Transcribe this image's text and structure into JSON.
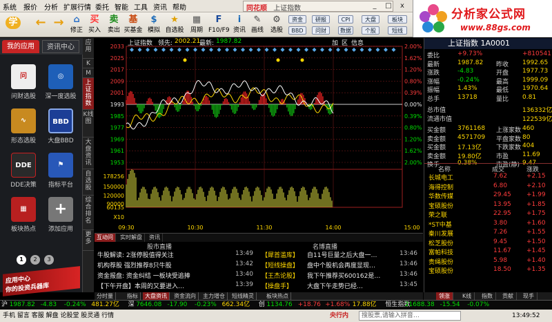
{
  "menubar": {
    "items": [
      "系统",
      "报价",
      "分析",
      "扩展行情",
      "委托",
      "智能",
      "工具",
      "资讯",
      "帮助"
    ],
    "brand": "同花顺",
    "title": "上证指数",
    "win_buttons": [
      "_",
      "□",
      "x"
    ]
  },
  "toolbar": {
    "buttons": [
      {
        "icon": "学",
        "label": ""
      },
      {
        "icon": "←",
        "label": ""
      },
      {
        "icon": "→",
        "label": ""
      },
      {
        "icon": "⌂",
        "label": ""
      },
      {
        "icon": "✔",
        "label": "修正"
      },
      {
        "icon": "买",
        "label": "买入"
      },
      {
        "icon": "卖",
        "label": "卖出"
      },
      {
        "icon": "基",
        "label": "买基金"
      },
      {
        "icon": "$",
        "label": "模拟"
      },
      {
        "icon": "★",
        "label": "自选股"
      },
      {
        "icon": "▦",
        "label": "周期"
      },
      {
        "icon": "F",
        "label": "F10/F9"
      },
      {
        "icon": "i",
        "label": "资讯"
      },
      {
        "icon": "✎",
        "label": "画线"
      },
      {
        "icon": "⚙",
        "label": "选股"
      }
    ],
    "small": [
      "资金",
      "BBD",
      "研报",
      "问财",
      "CPI",
      "数据",
      "大盘",
      "个股",
      "板块",
      "短线"
    ]
  },
  "logo": {
    "title": "分析家公式网",
    "url": "www.88gs.com"
  },
  "left": {
    "tab_active": "我的应用",
    "tab_other": "资讯中心",
    "apps": [
      {
        "label": "问财选股",
        "tile": "问",
        "color": "#eeeeee"
      },
      {
        "label": "深一度选股",
        "tile": "◎",
        "color": "#1e5fb8"
      },
      {
        "label": "形态选股",
        "tile": "∿",
        "color": "#c88a20"
      },
      {
        "label": "大盘BBD",
        "tile": "BBD",
        "color": "#1c3e96"
      },
      {
        "label": "DDE决策",
        "tile": "DDE",
        "color": "#2a2a2a"
      },
      {
        "label": "指标平台",
        "tile": "⚑",
        "color": "#2858b8"
      },
      {
        "label": "板块热点",
        "tile": "▦",
        "color": "#b82020"
      },
      {
        "label": "添加应用",
        "tile": "+",
        "color": "#777777"
      }
    ],
    "pages": [
      "1",
      "2",
      "3"
    ],
    "banner_line1": "应用中心",
    "banner_line2": "你的投资兵器库"
  },
  "vtabs": [
    "应用",
    "K",
    "M",
    "上证指数",
    "K线图",
    "大盘资讯",
    "自选股",
    "综合排名",
    "更多"
  ],
  "chart": {
    "index_name": "上证指数",
    "lead_label": "领先:",
    "lead_val": "2002.21",
    "latest_label": "最新:",
    "latest_val": "1987.82",
    "tools": [
      "加",
      "区",
      "信息"
    ],
    "y_labels": [
      "2033",
      "2025",
      "2017",
      "2009",
      "2001",
      "1993",
      "1985",
      "1977",
      "1969",
      "1961",
      "1953"
    ],
    "pct_labels": [
      "2.00%",
      "1.62%",
      "1.20%",
      "0.80%",
      "0.39%",
      "0.00%",
      "0.39%",
      "0.80%",
      "1.20%",
      "1.62%",
      "2.00%"
    ],
    "vol_labels": [
      "178256",
      "150000",
      "120000",
      "90000",
      "60135",
      "X10"
    ],
    "time_labels": [
      "09:30",
      "10:30",
      "11:30",
      "14:00",
      "15:00"
    ],
    "chart_data": {
      "type": "line",
      "title": "上证指数",
      "ref_price": 1993,
      "x": [
        "09:30",
        "10:30",
        "11:30",
        "14:00",
        "15:00"
      ],
      "series": [
        {
          "name": "上证指数",
          "values": [
            1975,
            2005,
            2004,
            1990
          ]
        },
        {
          "name": "领先",
          "values": [
            1978,
            1998,
            2000,
            1990
          ]
        }
      ]
    }
  },
  "news": {
    "tabs": [
      "互动问",
      "实时解盘",
      "资讯"
    ],
    "col1": "股市直播",
    "col2": "名博直播",
    "rows1": [
      {
        "text": "牛股解读: 2涨停股值得关注",
        "time": "13:49"
      },
      {
        "text": "机构荐股 强烈推荐8只牛股",
        "time": "13:42"
      },
      {
        "text": "资金报盘: 资金纠结 一板块受追捧",
        "time": "13:40"
      },
      {
        "text": "【下午开盘】本周的又要进入…",
        "time": "13:39"
      }
    ],
    "rows2": [
      {
        "tag": "【犀首滥库】",
        "text": "自11号巨量之后大盘一…",
        "time": "13:46"
      },
      {
        "tag": "【短线操盘】",
        "text": "盘中个股机会再度显现…",
        "time": "13:46"
      },
      {
        "tag": "【王杰论股】",
        "text": "我下午推荐买600162是…",
        "time": "13:46"
      },
      {
        "tag": "【操盘手】",
        "text": "大盘下午走势已经…",
        "time": "13:45"
      }
    ]
  },
  "bottomtabs": [
    "分时量",
    "指标",
    "大盘资讯",
    "资金流向",
    "主力增仓",
    "短线精灵",
    "板块热点"
  ],
  "quote": {
    "title": "上证指数 1A0001",
    "rows": [
      {
        "l": "委比",
        "v": "+9.73%",
        "r": "+810541"
      },
      {
        "l": "最新",
        "v": "1987.82",
        "rl": "昨收",
        "r": "1992.65"
      },
      {
        "l": "涨跌",
        "v": "-4.83",
        "rl": "开盘",
        "r": "1977.73"
      },
      {
        "l": "涨幅",
        "v": "-0.24%",
        "rl": "最高",
        "r": "1999.09"
      },
      {
        "l": "振幅",
        "v": "1.43%",
        "rl": "最低",
        "r": "1970.64"
      },
      {
        "l": "总手",
        "v": "13718",
        "rl": "量比",
        "r": "0.81"
      },
      {
        "l": "总市值",
        "v": "",
        "r": "136332亿"
      },
      {
        "l": "流通市值",
        "v": "",
        "r": "122539亿"
      },
      {
        "l": "买金额",
        "v": "3761168",
        "rl": "上涨家数",
        "r": "460"
      },
      {
        "l": "卖金额",
        "v": "4571709",
        "rl": "平盘家数",
        "r": "80"
      },
      {
        "l": "买金额",
        "v": "17.13亿",
        "rl": "下跌家数",
        "r": "404"
      },
      {
        "l": "卖金额",
        "v": "19.80亿",
        "rl": "市盈",
        "r": "11.69"
      },
      {
        "l": "换手",
        "v": "0.38%",
        "rl": "市盈(静)",
        "r": "9.47"
      }
    ],
    "stock_headers": [
      "名称",
      "成交",
      "涨跌"
    ],
    "stocks": [
      {
        "name": "长城电工",
        "price": "7.62",
        "chg": "+2.15"
      },
      {
        "name": "海得控制",
        "price": "6.80",
        "chg": "+2.10"
      },
      {
        "name": "华数传媒",
        "price": "29.45",
        "chg": "+1.99"
      },
      {
        "name": "宝硕股份",
        "price": "13.95",
        "chg": "+1.85"
      },
      {
        "name": "荣之联",
        "price": "22.95",
        "chg": "+1.75"
      },
      {
        "name": "*ST中基",
        "price": "3.80",
        "chg": "+1.60"
      },
      {
        "name": "秦川发展",
        "price": "7.26",
        "chg": "+1.55"
      },
      {
        "name": "松芝股份",
        "price": "9.45",
        "chg": "+1.50"
      },
      {
        "name": "富帕科技",
        "price": "11.67",
        "chg": "+1.45"
      },
      {
        "name": "贵绳股份",
        "price": "5.98",
        "chg": "+1.40"
      },
      {
        "name": "宝硕股份",
        "price": "18.50",
        "chg": "+1.35"
      }
    ],
    "tabs": [
      "领涨",
      "K线",
      "指数",
      "贡献",
      "现手"
    ]
  },
  "ticker": {
    "items": [
      {
        "n": "沪",
        "v": "1987.82",
        "c": "-4.83",
        "p": "-0.24%",
        "a": "481.27亿"
      },
      {
        "n": "深",
        "v": "7646.08",
        "c": "-17.90",
        "p": "-0.23%",
        "a": "662.34亿"
      },
      {
        "n": "创",
        "v": "1134.76",
        "c": "+18.76",
        "p": "+1.68%",
        "a": "17.88亿"
      },
      {
        "n": "恒生指数",
        "v": "21688.38",
        "c": "-15.54",
        "p": "-0.07%",
        "a": ""
      }
    ]
  },
  "status": {
    "left": "手机 留言 客服 解盘 论股堂 股灵通 行情",
    "center_label": "央行内",
    "center_text": "搜股票,请输入拼音…",
    "time": "13:49:52"
  }
}
